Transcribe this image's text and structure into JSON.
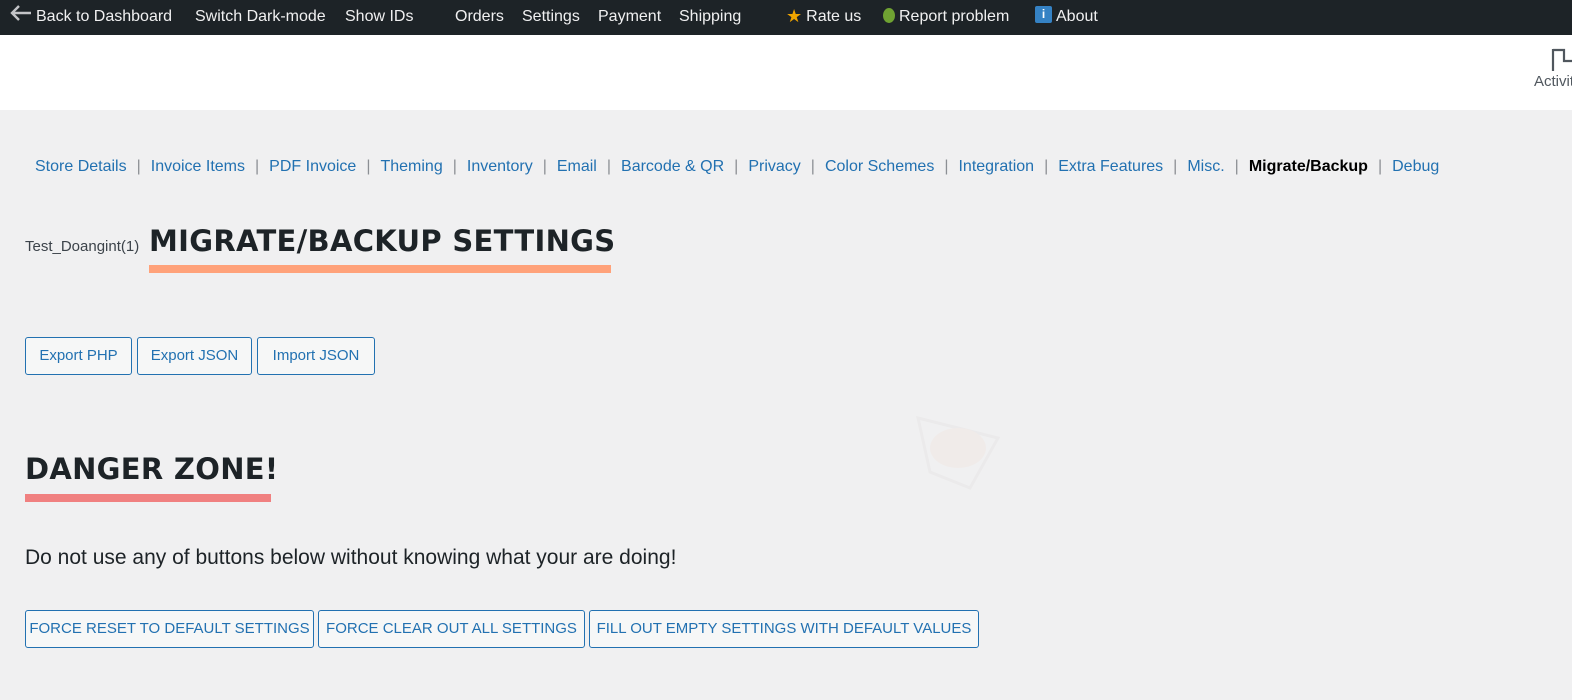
{
  "topbar": {
    "back": "Back to Dashboard",
    "dark_mode": "Switch Dark-mode",
    "show_ids": "Show IDs",
    "orders": "Orders",
    "settings": "Settings",
    "payment": "Payment",
    "shipping": "Shipping",
    "rate": "Rate us",
    "report": "Report problem",
    "about": "About"
  },
  "header": {
    "activity": "Activity"
  },
  "tabs": [
    "Store Details",
    "Invoice Items",
    "PDF Invoice",
    "Theming",
    "Inventory",
    "Email",
    "Barcode & QR",
    "Privacy",
    "Color Schemes",
    "Integration",
    "Extra Features",
    "Misc.",
    "Migrate/Backup",
    "Debug"
  ],
  "active_tab": "Migrate/Backup",
  "page": {
    "shop_name": "Test_Doangint(1)",
    "title": "MIGRATE/BACKUP SETTINGS",
    "export_php": "Export PHP",
    "export_json": "Export JSON",
    "import_json": "Import JSON",
    "danger_title": "DANGER ZONE!",
    "warning": "Do not use any of buttons below without knowing what your are doing!",
    "force_reset": "FORCE RESET TO DEFAULT SETTINGS",
    "force_clear": "FORCE CLEAR OUT ALL SETTINGS",
    "fill_empty": "FILL OUT EMPTY SETTINGS WITH DEFAULT VALUES"
  },
  "colors": {
    "topbar_bg": "#1d2327",
    "link": "#2271b1",
    "title_underline": "#ffa27a",
    "danger_underline": "#f08080"
  }
}
